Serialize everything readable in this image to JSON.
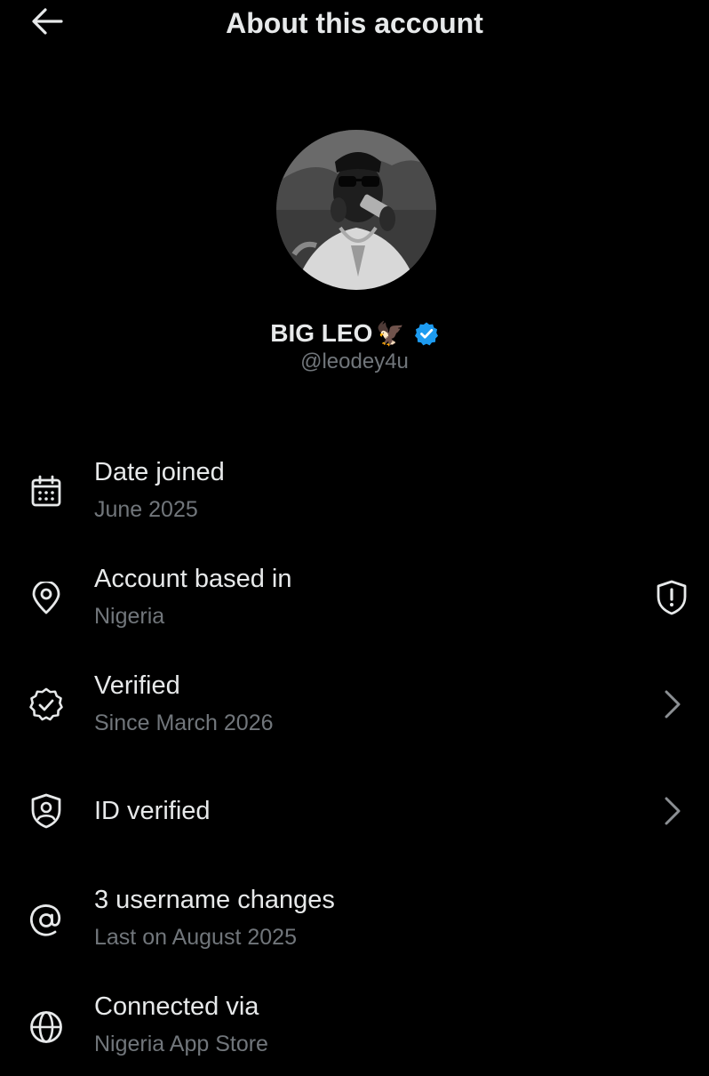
{
  "header": {
    "title": "About this account",
    "back_icon": "arrow-left-icon"
  },
  "profile": {
    "display_name": "BIG LEO",
    "name_emoji": "🦅",
    "verified_badge_color": "#1d9bf0",
    "handle": "@leodey4u"
  },
  "info": {
    "date_joined": {
      "icon": "calendar-icon",
      "title": "Date joined",
      "value": "June 2025"
    },
    "account_based_in": {
      "icon": "location-pin-icon",
      "title": "Account based in",
      "value": "Nigeria",
      "trailing_icon": "shield-alert-icon"
    },
    "verified": {
      "icon": "verified-badge-icon",
      "title": "Verified",
      "value": "Since March 2026",
      "trailing_icon": "chevron-right-icon"
    },
    "id_verified": {
      "icon": "id-shield-icon",
      "title": "ID verified",
      "trailing_icon": "chevron-right-icon"
    },
    "username_changes": {
      "icon": "at-sign-icon",
      "title": "3 username changes",
      "value": "Last on August 2025"
    },
    "connected_via": {
      "icon": "globe-icon",
      "title": "Connected via",
      "value": "Nigeria App Store"
    }
  },
  "colors": {
    "background": "#000000",
    "primary_text": "#e7e9ea",
    "secondary_text": "#71767b",
    "accent": "#1d9bf0"
  }
}
